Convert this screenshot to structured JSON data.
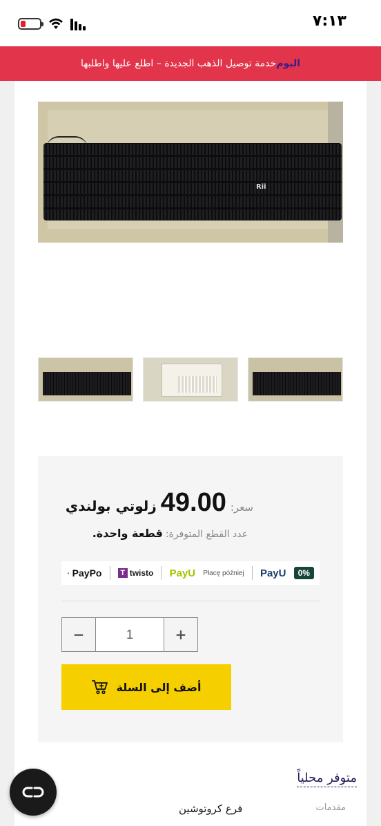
{
  "status_bar": {
    "time": "٧:١٣",
    "icons": [
      "battery-low-icon",
      "wifi-icon",
      "cellular-signal-icon"
    ]
  },
  "promo": {
    "highlight": "اليوم",
    "text": "خدمة توصيل الذهب الجديدة – اطلع عليها واطلبها"
  },
  "product": {
    "gallery": {
      "main_image": "keyboard-in-box-image",
      "thumbnails": [
        "keyboard-thumbnail-1",
        "keyboard-box-thumbnail-2",
        "keyboard-thumbnail-3"
      ],
      "keyboard_brand": "Rii"
    },
    "price": {
      "label": "سعر:",
      "amount": "49.00",
      "currency": "زلوتي بولندي"
    },
    "stock": {
      "label": "عدد القطع المتوفرة:",
      "value": "قطعة واحدة."
    },
    "payment_methods": {
      "paypo": "PayPo",
      "twisto": "twisto",
      "twisto_badge": "T",
      "payu": "PayU",
      "place_pozniej": "Płacę później",
      "payu2": "PayU",
      "zero_percent": "0%"
    },
    "quantity": {
      "minus": "−",
      "value": "1",
      "plus": "+"
    },
    "add_to_cart": {
      "label": "أضف إلى السلة"
    }
  },
  "availability": {
    "title": "متوفر محلياً",
    "offered_by_label": "مقدمات",
    "branch": "فرع كروتوشين"
  },
  "colors": {
    "promo_bg": "#e2344a",
    "promo_highlight": "#3a1d8a",
    "add_to_cart_bg": "#f6cf00",
    "availability_text": "#2a1a5e",
    "chat_button_bg": "#1a1a1a"
  }
}
